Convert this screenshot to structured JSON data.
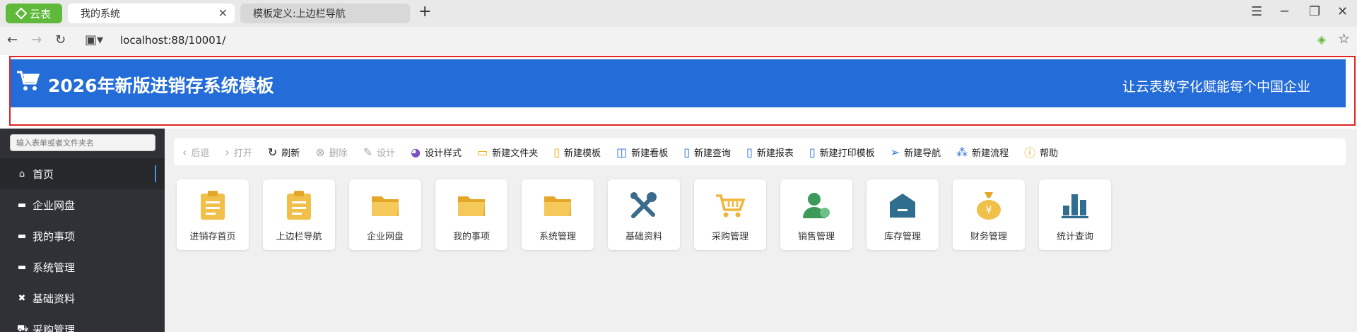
{
  "browser": {
    "app_badge": "云表",
    "tabs": [
      {
        "label": "我的系统",
        "active": true
      },
      {
        "label": "模板定义:上边栏导航",
        "active": false
      }
    ],
    "url": "localhost:88/10001/"
  },
  "banner": {
    "title": "2026年新版进销存系统模板",
    "slogan": "让云表数字化赋能每个中国企业",
    "bg_color": "#246cd7"
  },
  "sidebar": {
    "search_placeholder": "输入表单或者文件夹名",
    "items": [
      {
        "label": "首页",
        "icon": "home-icon",
        "active": true
      },
      {
        "label": "企业网盘",
        "icon": "folder-icon"
      },
      {
        "label": "我的事项",
        "icon": "folder-icon"
      },
      {
        "label": "系统管理",
        "icon": "folder-icon"
      },
      {
        "label": "基础资料",
        "icon": "tools-icon"
      },
      {
        "label": "采购管理",
        "icon": "cart-icon"
      }
    ]
  },
  "toolbar": {
    "back": "后退",
    "open": "打开",
    "refresh": "刷新",
    "delete": "删除",
    "design": "设计",
    "design_style": "设计样式",
    "new_folder": "新建文件夹",
    "new_template": "新建模板",
    "new_dashboard": "新建看板",
    "new_query": "新建查询",
    "new_report": "新建报表",
    "new_print_template": "新建打印模板",
    "new_nav": "新建导航",
    "new_flow": "新建流程",
    "help": "帮助"
  },
  "grid": {
    "items": [
      {
        "label": "进销存首页",
        "icon": "clipboard-icon"
      },
      {
        "label": "上边栏导航",
        "icon": "clipboard-icon"
      },
      {
        "label": "企业网盘",
        "icon": "folder-icon"
      },
      {
        "label": "我的事项",
        "icon": "folder-icon"
      },
      {
        "label": "系统管理",
        "icon": "folder-icon"
      },
      {
        "label": "基础资料",
        "icon": "tools-icon"
      },
      {
        "label": "采购管理",
        "icon": "cart-icon"
      },
      {
        "label": "销售管理",
        "icon": "user-icon"
      },
      {
        "label": "库存管理",
        "icon": "warehouse-icon"
      },
      {
        "label": "财务管理",
        "icon": "money-bag-icon"
      },
      {
        "label": "统计查询",
        "icon": "bar-chart-icon"
      }
    ]
  }
}
